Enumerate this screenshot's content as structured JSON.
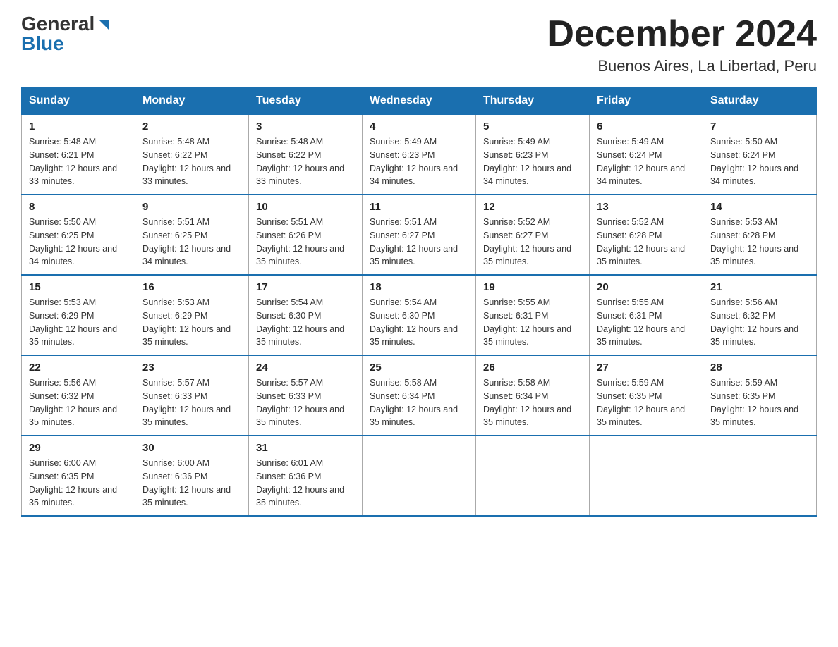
{
  "header": {
    "logo_general": "General",
    "logo_blue": "Blue",
    "title": "December 2024",
    "subtitle": "Buenos Aires, La Libertad, Peru"
  },
  "days_of_week": [
    "Sunday",
    "Monday",
    "Tuesday",
    "Wednesday",
    "Thursday",
    "Friday",
    "Saturday"
  ],
  "weeks": [
    [
      {
        "day": "1",
        "sunrise": "5:48 AM",
        "sunset": "6:21 PM",
        "daylight": "12 hours and 33 minutes."
      },
      {
        "day": "2",
        "sunrise": "5:48 AM",
        "sunset": "6:22 PM",
        "daylight": "12 hours and 33 minutes."
      },
      {
        "day": "3",
        "sunrise": "5:48 AM",
        "sunset": "6:22 PM",
        "daylight": "12 hours and 33 minutes."
      },
      {
        "day": "4",
        "sunrise": "5:49 AM",
        "sunset": "6:23 PM",
        "daylight": "12 hours and 34 minutes."
      },
      {
        "day": "5",
        "sunrise": "5:49 AM",
        "sunset": "6:23 PM",
        "daylight": "12 hours and 34 minutes."
      },
      {
        "day": "6",
        "sunrise": "5:49 AM",
        "sunset": "6:24 PM",
        "daylight": "12 hours and 34 minutes."
      },
      {
        "day": "7",
        "sunrise": "5:50 AM",
        "sunset": "6:24 PM",
        "daylight": "12 hours and 34 minutes."
      }
    ],
    [
      {
        "day": "8",
        "sunrise": "5:50 AM",
        "sunset": "6:25 PM",
        "daylight": "12 hours and 34 minutes."
      },
      {
        "day": "9",
        "sunrise": "5:51 AM",
        "sunset": "6:25 PM",
        "daylight": "12 hours and 34 minutes."
      },
      {
        "day": "10",
        "sunrise": "5:51 AM",
        "sunset": "6:26 PM",
        "daylight": "12 hours and 35 minutes."
      },
      {
        "day": "11",
        "sunrise": "5:51 AM",
        "sunset": "6:27 PM",
        "daylight": "12 hours and 35 minutes."
      },
      {
        "day": "12",
        "sunrise": "5:52 AM",
        "sunset": "6:27 PM",
        "daylight": "12 hours and 35 minutes."
      },
      {
        "day": "13",
        "sunrise": "5:52 AM",
        "sunset": "6:28 PM",
        "daylight": "12 hours and 35 minutes."
      },
      {
        "day": "14",
        "sunrise": "5:53 AM",
        "sunset": "6:28 PM",
        "daylight": "12 hours and 35 minutes."
      }
    ],
    [
      {
        "day": "15",
        "sunrise": "5:53 AM",
        "sunset": "6:29 PM",
        "daylight": "12 hours and 35 minutes."
      },
      {
        "day": "16",
        "sunrise": "5:53 AM",
        "sunset": "6:29 PM",
        "daylight": "12 hours and 35 minutes."
      },
      {
        "day": "17",
        "sunrise": "5:54 AM",
        "sunset": "6:30 PM",
        "daylight": "12 hours and 35 minutes."
      },
      {
        "day": "18",
        "sunrise": "5:54 AM",
        "sunset": "6:30 PM",
        "daylight": "12 hours and 35 minutes."
      },
      {
        "day": "19",
        "sunrise": "5:55 AM",
        "sunset": "6:31 PM",
        "daylight": "12 hours and 35 minutes."
      },
      {
        "day": "20",
        "sunrise": "5:55 AM",
        "sunset": "6:31 PM",
        "daylight": "12 hours and 35 minutes."
      },
      {
        "day": "21",
        "sunrise": "5:56 AM",
        "sunset": "6:32 PM",
        "daylight": "12 hours and 35 minutes."
      }
    ],
    [
      {
        "day": "22",
        "sunrise": "5:56 AM",
        "sunset": "6:32 PM",
        "daylight": "12 hours and 35 minutes."
      },
      {
        "day": "23",
        "sunrise": "5:57 AM",
        "sunset": "6:33 PM",
        "daylight": "12 hours and 35 minutes."
      },
      {
        "day": "24",
        "sunrise": "5:57 AM",
        "sunset": "6:33 PM",
        "daylight": "12 hours and 35 minutes."
      },
      {
        "day": "25",
        "sunrise": "5:58 AM",
        "sunset": "6:34 PM",
        "daylight": "12 hours and 35 minutes."
      },
      {
        "day": "26",
        "sunrise": "5:58 AM",
        "sunset": "6:34 PM",
        "daylight": "12 hours and 35 minutes."
      },
      {
        "day": "27",
        "sunrise": "5:59 AM",
        "sunset": "6:35 PM",
        "daylight": "12 hours and 35 minutes."
      },
      {
        "day": "28",
        "sunrise": "5:59 AM",
        "sunset": "6:35 PM",
        "daylight": "12 hours and 35 minutes."
      }
    ],
    [
      {
        "day": "29",
        "sunrise": "6:00 AM",
        "sunset": "6:35 PM",
        "daylight": "12 hours and 35 minutes."
      },
      {
        "day": "30",
        "sunrise": "6:00 AM",
        "sunset": "6:36 PM",
        "daylight": "12 hours and 35 minutes."
      },
      {
        "day": "31",
        "sunrise": "6:01 AM",
        "sunset": "6:36 PM",
        "daylight": "12 hours and 35 minutes."
      },
      null,
      null,
      null,
      null
    ]
  ]
}
